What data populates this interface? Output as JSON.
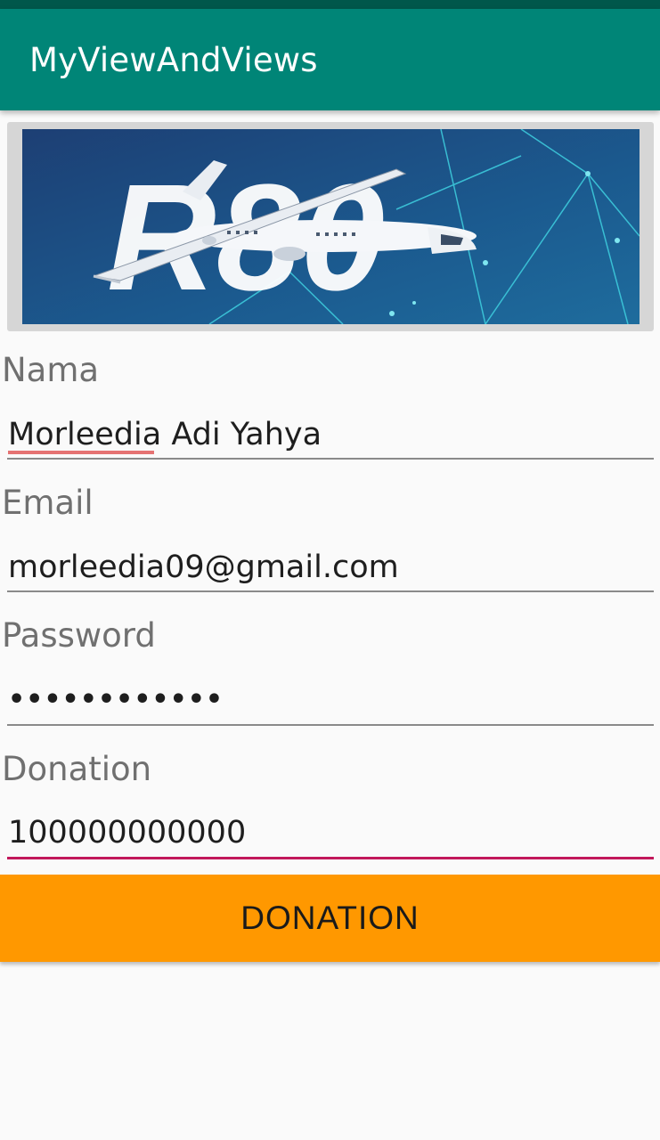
{
  "app": {
    "title": "MyViewAndViews"
  },
  "banner": {
    "text": "R80"
  },
  "form": {
    "name": {
      "label": "Nama",
      "value_first": "Morleedia",
      "value_rest": " Adi Yahya"
    },
    "email": {
      "label": "Email",
      "value": "morleedia09@gmail.com"
    },
    "password": {
      "label": "Password",
      "value": "••••••••••••"
    },
    "donation": {
      "label": "Donation",
      "value": "100000000000"
    }
  },
  "button": {
    "label": "DONATION"
  },
  "colors": {
    "primary": "#008577",
    "primary_dark": "#00574b",
    "accent": "#c2185b",
    "button": "#ff9800"
  }
}
